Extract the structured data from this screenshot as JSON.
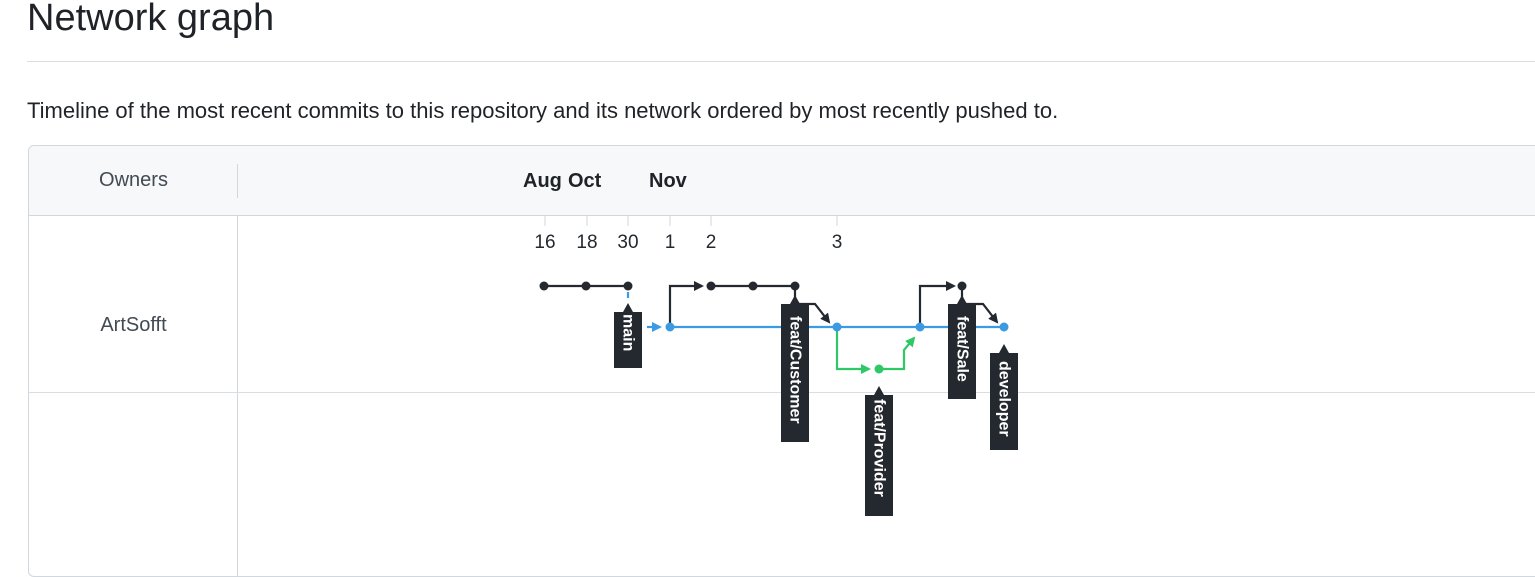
{
  "page": {
    "title": "Network graph",
    "description": "Timeline of the most recent commits to this repository and its network ordered by most recently pushed to."
  },
  "graph": {
    "owners_header": "Owners",
    "months": [
      "Aug",
      "Oct",
      "Nov"
    ],
    "days": [
      "16",
      "18",
      "30",
      "1",
      "2",
      "3"
    ],
    "owners": [
      "ArtSofft"
    ],
    "branches": {
      "main": "main",
      "feat_customer": "feat/Customer",
      "feat_provider": "feat/Provider",
      "feat_sale": "feat/Sale",
      "developer": "developer"
    },
    "colors": {
      "black_line": "#24292f",
      "blue_line": "#3b9ae1",
      "green_line": "#2ec866",
      "label_bg": "#24292f",
      "label_text": "#ffffff"
    }
  }
}
